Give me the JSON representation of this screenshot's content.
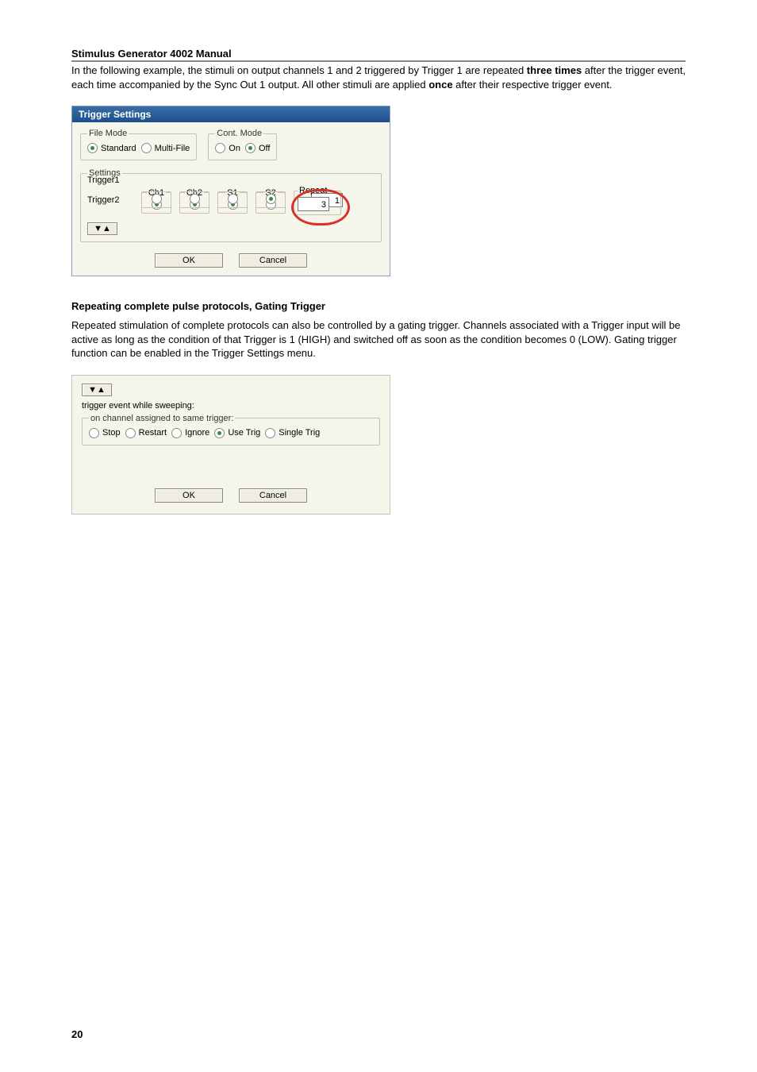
{
  "header": {
    "title": "Stimulus Generator 4002 Manual"
  },
  "intro": {
    "pre": "In the following example, the stimuli on output channels 1 and 2 triggered by Trigger 1 are repeated ",
    "bold1": "three times",
    "mid": " after the trigger event, each time accompanied by the Sync Out 1 output. All other stimuli are applied ",
    "bold2": "once",
    "post": " after their respective trigger event."
  },
  "dialog1": {
    "title": "Trigger Settings",
    "fileMode": {
      "legend": "File Mode",
      "options": [
        {
          "label": "Standard",
          "checked": true
        },
        {
          "label": "Multi-File",
          "checked": false
        }
      ]
    },
    "contMode": {
      "legend": "Cont. Mode",
      "options": [
        {
          "label": "On",
          "checked": false
        },
        {
          "label": "Off",
          "checked": true
        }
      ]
    },
    "settings": {
      "legend": "Settings",
      "cols": [
        "Ch1",
        "Ch2",
        "S1",
        "S2"
      ],
      "repeatLegend": "Repeat",
      "rows": [
        {
          "label": "Trigger1",
          "cells": [
            true,
            true,
            true,
            false
          ],
          "repeat": "3"
        },
        {
          "label": "Trigger2",
          "cells": [
            false,
            false,
            false,
            true
          ],
          "repeat": "1"
        }
      ],
      "expandButton": "▼▲"
    },
    "buttons": {
      "ok": "OK",
      "cancel": "Cancel"
    }
  },
  "section2": {
    "heading": "Repeating complete pulse protocols, Gating Trigger",
    "para": "Repeated stimulation of complete protocols can also be controlled by a gating trigger. Channels associated with a Trigger input will be active as long as the condition of that Trigger is 1 (HIGH) and switched off as soon as the condition becomes 0 (LOW). Gating trigger function can be enabled in the Trigger Settings menu."
  },
  "dialog2": {
    "collapseButton": "▼▲",
    "sweepText": "trigger event while sweeping:",
    "group": {
      "legend": "on channel assigned to same trigger:",
      "options": [
        {
          "label": "Stop",
          "checked": false
        },
        {
          "label": "Restart",
          "checked": false
        },
        {
          "label": "Ignore",
          "checked": false
        },
        {
          "label": "Use Trig",
          "checked": true
        },
        {
          "label": "Single Trig",
          "checked": false
        }
      ]
    },
    "buttons": {
      "ok": "OK",
      "cancel": "Cancel"
    }
  },
  "pageNumber": "20"
}
